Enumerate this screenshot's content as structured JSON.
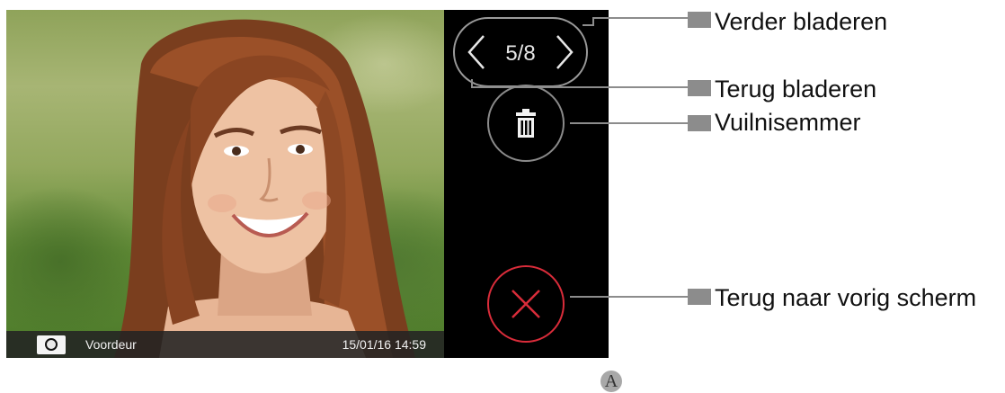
{
  "screen": {
    "counter": "5/8",
    "caption": {
      "camera_icon": "camera-icon",
      "location": "Voordeur",
      "datetime": "15/01/16 14:59"
    },
    "buttons": {
      "prev_icon": "chevron-left-icon",
      "next_icon": "chevron-right-icon",
      "trash_icon": "trash-icon",
      "close_icon": "close-icon"
    },
    "colors": {
      "close_accent": "#d92c3a",
      "outline": "#9a9a9a",
      "callout_box": "#8c8c8c"
    }
  },
  "callouts": {
    "next": "Verder bladeren",
    "prev": "Terug bladeren",
    "trash": "Vuilnisemmer",
    "back": "Terug naar vorig scherm"
  },
  "figure_marker": "A"
}
